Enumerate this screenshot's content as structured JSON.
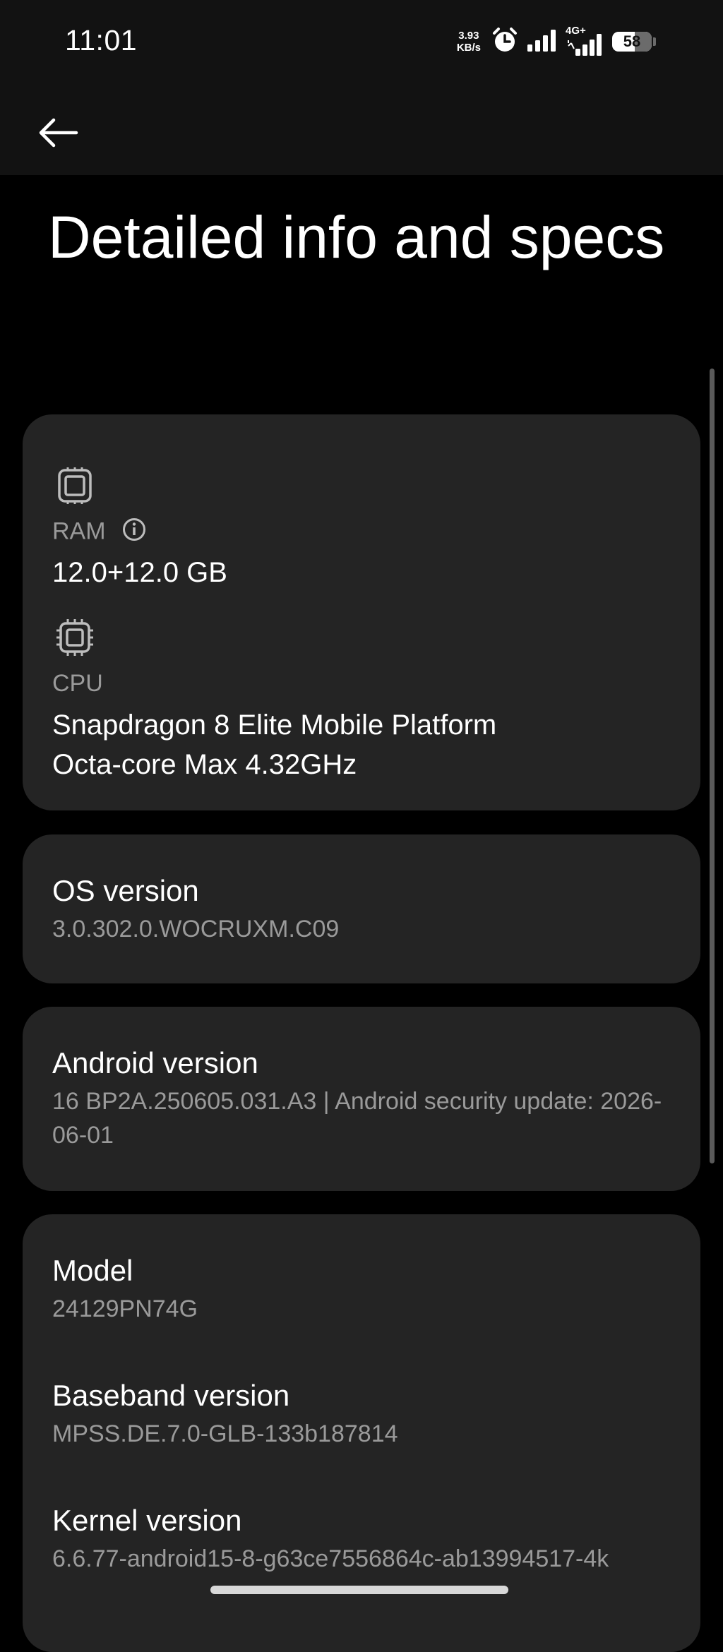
{
  "status_bar": {
    "time": "11:01",
    "net_speed_value": "3.93",
    "net_speed_unit": "KB/s",
    "network_type": "4G+",
    "battery_level": "58",
    "battery_fraction": 0.58,
    "icons": [
      "alarm-icon",
      "signal-icon",
      "signal-4g-icon",
      "battery-icon"
    ]
  },
  "toolbar": {
    "back_icon": "arrow-left-icon"
  },
  "page": {
    "title": "Detailed info and specs"
  },
  "hardware_card": {
    "ram": {
      "icon": "memory-chip-icon",
      "label": "RAM",
      "info_icon": "info-icon",
      "value": "12.0+12.0 GB"
    },
    "cpu": {
      "icon": "cpu-chip-icon",
      "label": "CPU",
      "value_line1": "Snapdragon 8 Elite Mobile Platform",
      "value_line2": "Octa-core Max 4.32GHz"
    }
  },
  "os_card": {
    "label": "OS version",
    "value": "3.0.302.0.WOCRUXM.C09"
  },
  "android_card": {
    "label": "Android version",
    "value": "16 BP2A.250605.031.A3 | Android security update: 2026-06-01"
  },
  "device_card": {
    "model_label": "Model",
    "model_value": "24129PN74G",
    "baseband_label": "Baseband version",
    "baseband_value": "MPSS.DE.7.0-GLB-133b187814",
    "kernel_label": "Kernel version",
    "kernel_value": "6.6.77-android15-8-g63ce7556864c-ab13994517-4k"
  }
}
